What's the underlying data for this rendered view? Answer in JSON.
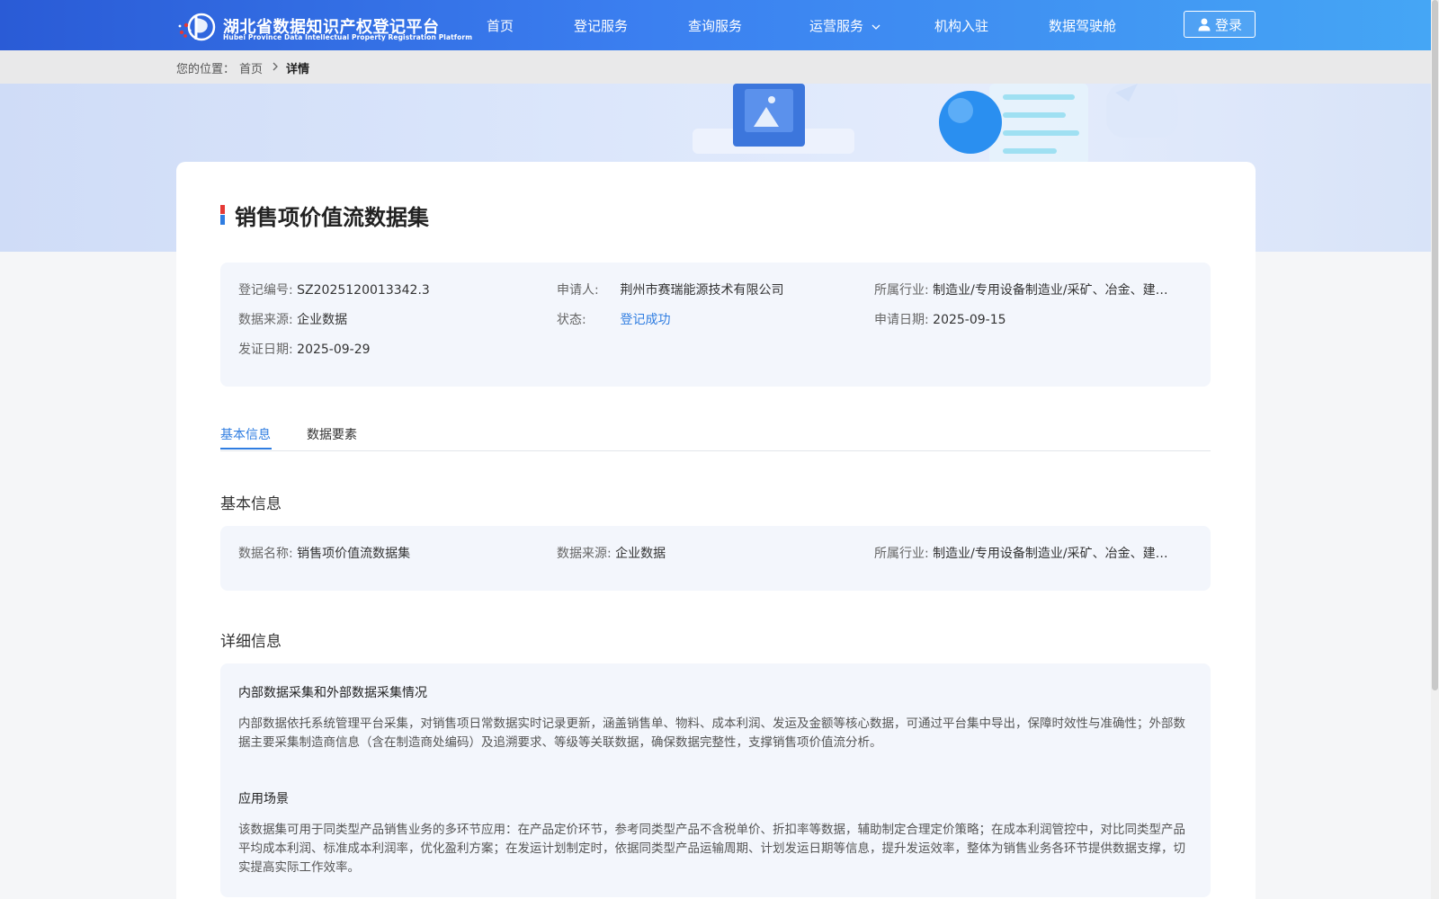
{
  "header": {
    "logo_cn": "湖北省数据知识产权登记平台",
    "logo_en": "Hubei Province Data Intellectual Property Registration Platform",
    "nav": [
      "首页",
      "登记服务",
      "查询服务",
      "运营服务",
      "机构入驻",
      "数据驾驶舱"
    ],
    "login_label": "登录"
  },
  "breadcrumb": {
    "prefix": "您的位置：",
    "home": "首页",
    "current": "详情"
  },
  "record": {
    "title": "销售项价值流数据集",
    "summary": {
      "reg_no_label": "登记编号:",
      "reg_no": "SZ2025120013342.3",
      "applicant_label": "申请人:",
      "applicant": "荆州市赛瑞能源技术有限公司",
      "industry_label": "所属行业:",
      "industry": "制造业/专用设备制造业/采矿、冶金、建…",
      "source_label": "数据来源:",
      "source": "企业数据",
      "status_label": "状态:",
      "status": "登记成功",
      "apply_date_label": "申请日期:",
      "apply_date": "2025-09-15",
      "issue_date_label": "发证日期:",
      "issue_date": "2025-09-29"
    }
  },
  "tabs": [
    "基本信息",
    "数据要素"
  ],
  "basic": {
    "heading": "基本信息",
    "name_label": "数据名称:",
    "name": "销售项价值流数据集",
    "source_label": "数据来源:",
    "source": "企业数据",
    "industry_label": "所属行业:",
    "industry": "制造业/专用设备制造业/采矿、冶金、建…"
  },
  "detail": {
    "heading": "详细信息",
    "collect_title": "内部数据采集和外部数据采集情况",
    "collect_text": "内部数据依托系统管理平台采集，对销售项日常数据实时记录更新，涵盖销售单、物料、成本利润、发运及金额等核心数据，可通过平台集中导出，保障时效性与准确性；外部数据主要采集制造商信息（含在制造商处编码）及追溯要求、等级等关联数据，确保数据完整性，支撑销售项价值流分析。",
    "scene_title": "应用场景",
    "scene_text": "该数据集可用于同类型产品销售业务的多环节应用：在产品定价环节，参考同类型产品不含税单价、折扣率等数据，辅助制定合理定价策略；在成本利润管控中，对比同类型产品平均成本利润、标准成本利润率，优化盈利方案；在发运计划制定时，依据同类型产品运输周期、计划发运日期等信息，提升发运效率，整体为销售业务各环节提供数据支撑，切实提高实际工作效率。"
  },
  "colors": {
    "accent": "#2f7de1",
    "header_start": "#2a5bd6",
    "header_end": "#45a6f5",
    "panel_bg": "#f3f6fc"
  }
}
